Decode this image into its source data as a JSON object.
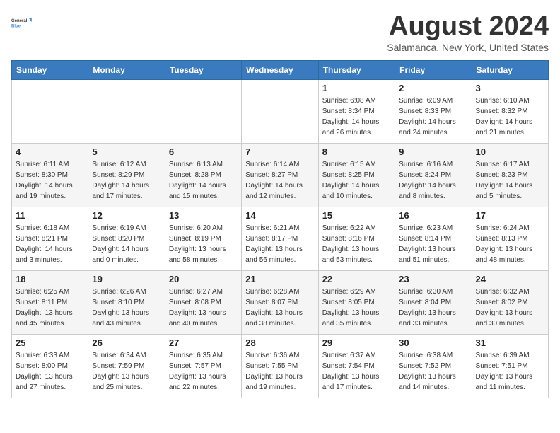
{
  "logo": {
    "line1": "General",
    "line2": "Blue"
  },
  "header": {
    "month": "August 2024",
    "location": "Salamanca, New York, United States"
  },
  "weekdays": [
    "Sunday",
    "Monday",
    "Tuesday",
    "Wednesday",
    "Thursday",
    "Friday",
    "Saturday"
  ],
  "weeks": [
    [
      {
        "day": "",
        "info": ""
      },
      {
        "day": "",
        "info": ""
      },
      {
        "day": "",
        "info": ""
      },
      {
        "day": "",
        "info": ""
      },
      {
        "day": "1",
        "info": "Sunrise: 6:08 AM\nSunset: 8:34 PM\nDaylight: 14 hours and 26 minutes."
      },
      {
        "day": "2",
        "info": "Sunrise: 6:09 AM\nSunset: 8:33 PM\nDaylight: 14 hours and 24 minutes."
      },
      {
        "day": "3",
        "info": "Sunrise: 6:10 AM\nSunset: 8:32 PM\nDaylight: 14 hours and 21 minutes."
      }
    ],
    [
      {
        "day": "4",
        "info": "Sunrise: 6:11 AM\nSunset: 8:30 PM\nDaylight: 14 hours and 19 minutes."
      },
      {
        "day": "5",
        "info": "Sunrise: 6:12 AM\nSunset: 8:29 PM\nDaylight: 14 hours and 17 minutes."
      },
      {
        "day": "6",
        "info": "Sunrise: 6:13 AM\nSunset: 8:28 PM\nDaylight: 14 hours and 15 minutes."
      },
      {
        "day": "7",
        "info": "Sunrise: 6:14 AM\nSunset: 8:27 PM\nDaylight: 14 hours and 12 minutes."
      },
      {
        "day": "8",
        "info": "Sunrise: 6:15 AM\nSunset: 8:25 PM\nDaylight: 14 hours and 10 minutes."
      },
      {
        "day": "9",
        "info": "Sunrise: 6:16 AM\nSunset: 8:24 PM\nDaylight: 14 hours and 8 minutes."
      },
      {
        "day": "10",
        "info": "Sunrise: 6:17 AM\nSunset: 8:23 PM\nDaylight: 14 hours and 5 minutes."
      }
    ],
    [
      {
        "day": "11",
        "info": "Sunrise: 6:18 AM\nSunset: 8:21 PM\nDaylight: 14 hours and 3 minutes."
      },
      {
        "day": "12",
        "info": "Sunrise: 6:19 AM\nSunset: 8:20 PM\nDaylight: 14 hours and 0 minutes."
      },
      {
        "day": "13",
        "info": "Sunrise: 6:20 AM\nSunset: 8:19 PM\nDaylight: 13 hours and 58 minutes."
      },
      {
        "day": "14",
        "info": "Sunrise: 6:21 AM\nSunset: 8:17 PM\nDaylight: 13 hours and 56 minutes."
      },
      {
        "day": "15",
        "info": "Sunrise: 6:22 AM\nSunset: 8:16 PM\nDaylight: 13 hours and 53 minutes."
      },
      {
        "day": "16",
        "info": "Sunrise: 6:23 AM\nSunset: 8:14 PM\nDaylight: 13 hours and 51 minutes."
      },
      {
        "day": "17",
        "info": "Sunrise: 6:24 AM\nSunset: 8:13 PM\nDaylight: 13 hours and 48 minutes."
      }
    ],
    [
      {
        "day": "18",
        "info": "Sunrise: 6:25 AM\nSunset: 8:11 PM\nDaylight: 13 hours and 45 minutes."
      },
      {
        "day": "19",
        "info": "Sunrise: 6:26 AM\nSunset: 8:10 PM\nDaylight: 13 hours and 43 minutes."
      },
      {
        "day": "20",
        "info": "Sunrise: 6:27 AM\nSunset: 8:08 PM\nDaylight: 13 hours and 40 minutes."
      },
      {
        "day": "21",
        "info": "Sunrise: 6:28 AM\nSunset: 8:07 PM\nDaylight: 13 hours and 38 minutes."
      },
      {
        "day": "22",
        "info": "Sunrise: 6:29 AM\nSunset: 8:05 PM\nDaylight: 13 hours and 35 minutes."
      },
      {
        "day": "23",
        "info": "Sunrise: 6:30 AM\nSunset: 8:04 PM\nDaylight: 13 hours and 33 minutes."
      },
      {
        "day": "24",
        "info": "Sunrise: 6:32 AM\nSunset: 8:02 PM\nDaylight: 13 hours and 30 minutes."
      }
    ],
    [
      {
        "day": "25",
        "info": "Sunrise: 6:33 AM\nSunset: 8:00 PM\nDaylight: 13 hours and 27 minutes."
      },
      {
        "day": "26",
        "info": "Sunrise: 6:34 AM\nSunset: 7:59 PM\nDaylight: 13 hours and 25 minutes."
      },
      {
        "day": "27",
        "info": "Sunrise: 6:35 AM\nSunset: 7:57 PM\nDaylight: 13 hours and 22 minutes."
      },
      {
        "day": "28",
        "info": "Sunrise: 6:36 AM\nSunset: 7:55 PM\nDaylight: 13 hours and 19 minutes."
      },
      {
        "day": "29",
        "info": "Sunrise: 6:37 AM\nSunset: 7:54 PM\nDaylight: 13 hours and 17 minutes."
      },
      {
        "day": "30",
        "info": "Sunrise: 6:38 AM\nSunset: 7:52 PM\nDaylight: 13 hours and 14 minutes."
      },
      {
        "day": "31",
        "info": "Sunrise: 6:39 AM\nSunset: 7:51 PM\nDaylight: 13 hours and 11 minutes."
      }
    ]
  ]
}
